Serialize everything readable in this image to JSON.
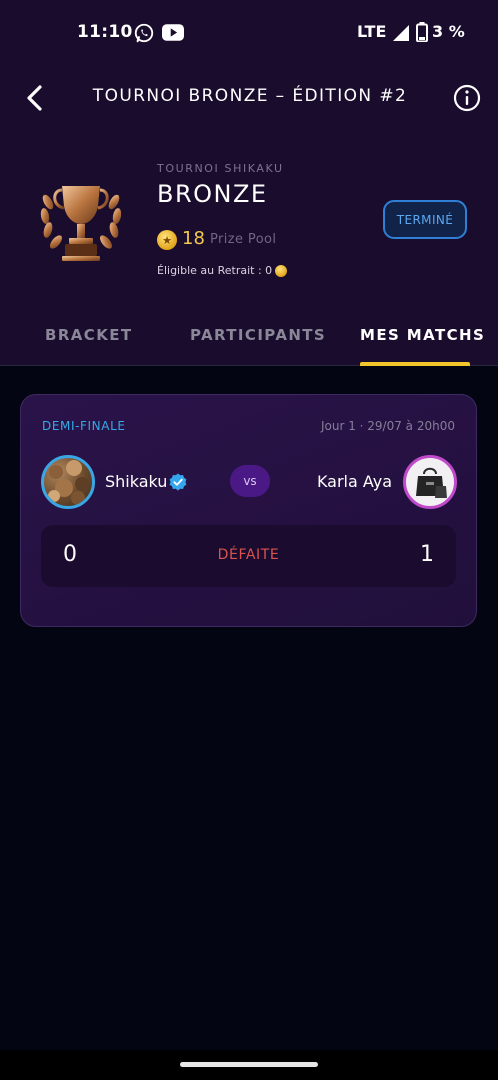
{
  "status_bar": {
    "time": "11:10",
    "network": "LTE",
    "battery": "3 %",
    "icons": [
      "whatsapp-icon",
      "youtube-icon",
      "signal-icon",
      "battery-icon"
    ]
  },
  "header": {
    "title": "TOURNOI BRONZE – ÉDITION #2",
    "back_icon": "chevron-left-icon",
    "info_icon": "info-icon"
  },
  "tournament": {
    "subtitle": "TOURNOI SHIKAKU",
    "tier": "BRONZE",
    "prize_value": "18",
    "prize_label": "Prize Pool",
    "eligible_text": "Éligible au Retrait : 0",
    "status": "TERMINÉ"
  },
  "tabs": [
    {
      "label": "BRACKET",
      "active": false
    },
    {
      "label": "PARTICIPANTS",
      "active": false
    },
    {
      "label": "MES MATCHS",
      "active": true
    }
  ],
  "match": {
    "round": "DEMI-FINALE",
    "date": "Jour 1 · 29/07 à 20h00",
    "player1": {
      "name": "Shikaku",
      "verified": true
    },
    "vs": "vs",
    "player2": {
      "name": "Karla Aya"
    },
    "score1": "0",
    "result": "DÉFAITE",
    "score2": "1"
  },
  "colors": {
    "header_bg": "#1a0c2c",
    "page_bg": "#030612",
    "accent_gold": "#f2c52a",
    "accent_blue": "#36a9e6",
    "defeat": "#d9534f"
  }
}
